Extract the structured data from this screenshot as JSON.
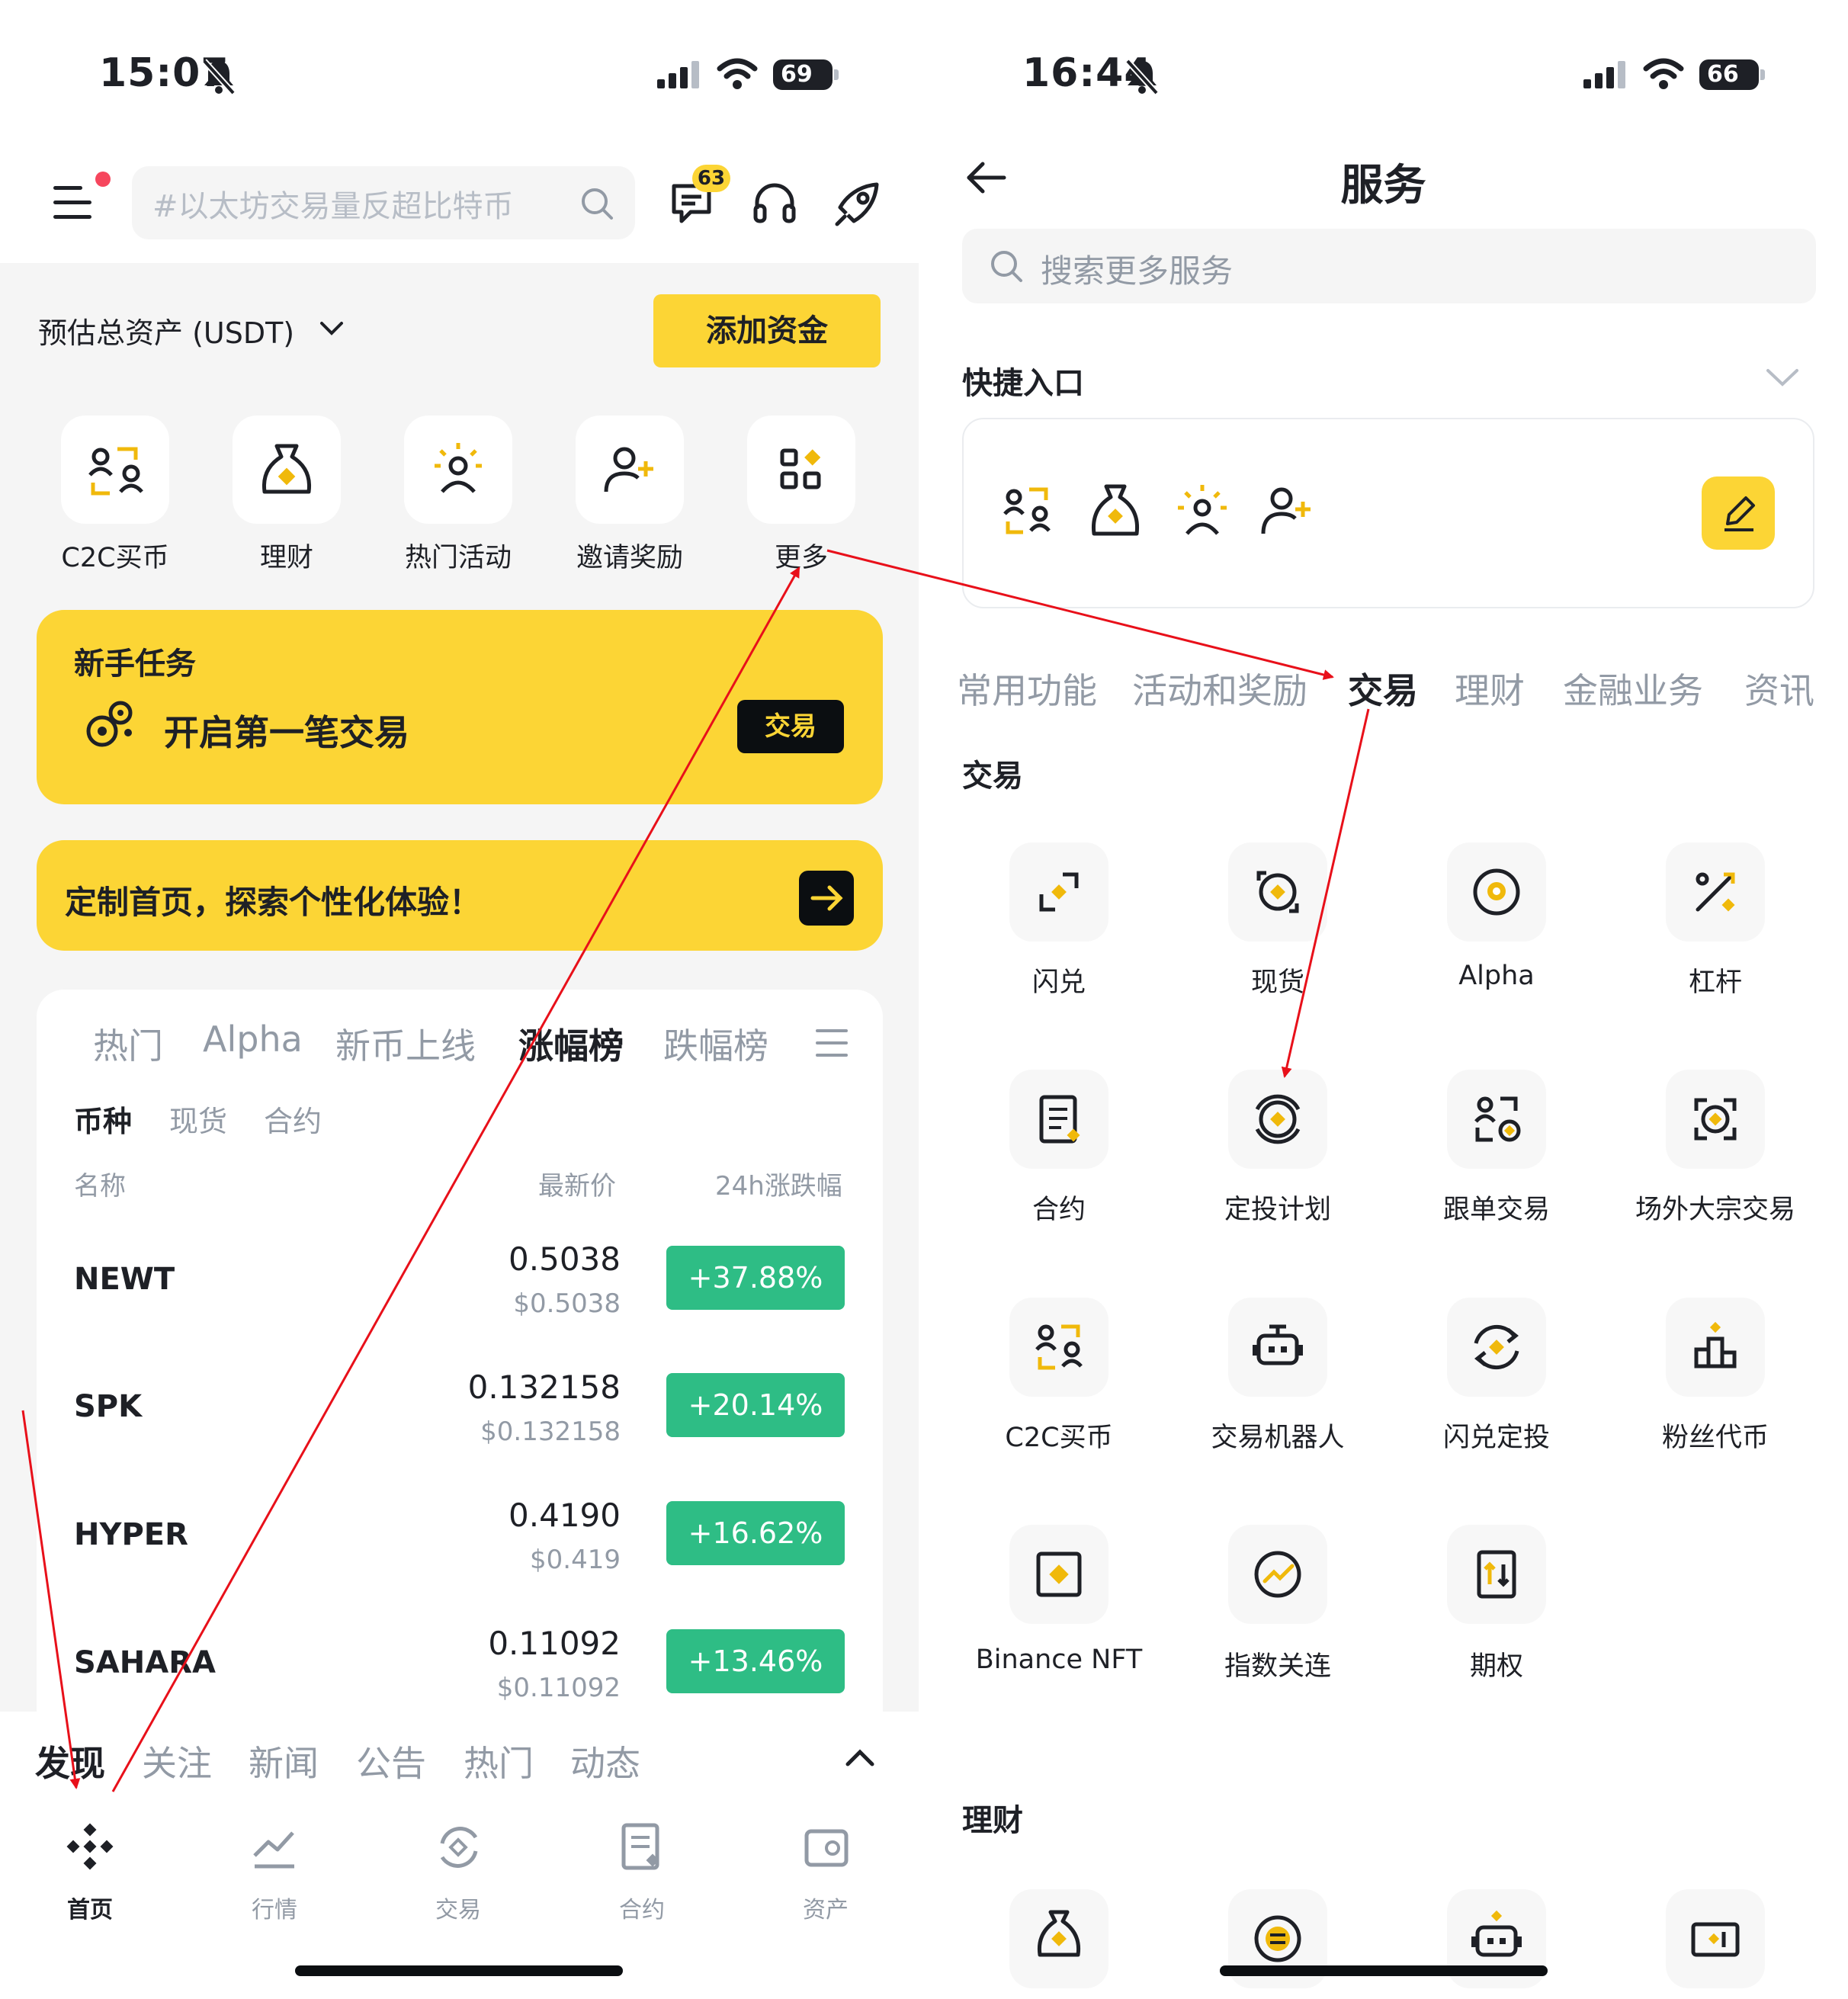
{
  "left": {
    "status": {
      "time": "15:07",
      "battery": "69"
    },
    "header": {
      "search_placeholder": "#以太坊交易量反超比特币",
      "notification_count": "63"
    },
    "assets": {
      "label": "预估总资产 (USDT)",
      "add_funds": "添加资金"
    },
    "quick_actions": [
      {
        "label": "C2C买币",
        "icon": "c2c-icon"
      },
      {
        "label": "理财",
        "icon": "money-bag-icon"
      },
      {
        "label": "热门活动",
        "icon": "activity-icon"
      },
      {
        "label": "邀请奖励",
        "icon": "invite-icon"
      },
      {
        "label": "更多",
        "icon": "more-grid-icon"
      }
    ],
    "task": {
      "title": "新手任务",
      "main": "开启第一笔交易",
      "button": "交易"
    },
    "custom": {
      "text": "定制首页，探索个性化体验！"
    },
    "market": {
      "tabs": [
        "热门",
        "Alpha",
        "新币上线",
        "涨幅榜",
        "跌幅榜"
      ],
      "active_tab": "涨幅榜",
      "subtabs": [
        "币种",
        "现货",
        "合约"
      ],
      "columns": {
        "name": "名称",
        "price": "最新价",
        "change": "24h涨跌幅"
      },
      "rows": [
        {
          "coin": "NEWT",
          "price": "0.5038",
          "usd": "$0.5038",
          "change": "+37.88%"
        },
        {
          "coin": "SPK",
          "price": "0.132158",
          "usd": "$0.132158",
          "change": "+20.14%"
        },
        {
          "coin": "HYPER",
          "price": "0.4190",
          "usd": "$0.419",
          "change": "+16.62%"
        },
        {
          "coin": "SAHARA",
          "price": "0.11092",
          "usd": "$0.11092",
          "change": "+13.46%"
        }
      ]
    },
    "feed_tabs": [
      "发现",
      "关注",
      "新闻",
      "公告",
      "热门",
      "动态"
    ],
    "bottom_nav": [
      "首页",
      "行情",
      "交易",
      "合约",
      "资产"
    ]
  },
  "right": {
    "status": {
      "time": "16:44",
      "battery": "66"
    },
    "title": "服务",
    "search_placeholder": "搜索更多服务",
    "quick_entry": "快捷入口",
    "category_tabs": [
      "常用功能",
      "活动和奖励",
      "交易",
      "理财",
      "金融业务",
      "资讯"
    ],
    "section_trade": "交易",
    "services": [
      "闪兑",
      "现货",
      "Alpha",
      "杠杆",
      "合约",
      "定投计划",
      "跟单交易",
      "场外大宗交易",
      "C2C买币",
      "交易机器人",
      "闪兑定投",
      "粉丝代币",
      "Binance NFT",
      "指数关连",
      "期权"
    ],
    "section_finance": "理财"
  },
  "colors": {
    "brand_yellow": "#fcd535",
    "up_green": "#2ebd85",
    "annotation_red": "#e8101a"
  }
}
